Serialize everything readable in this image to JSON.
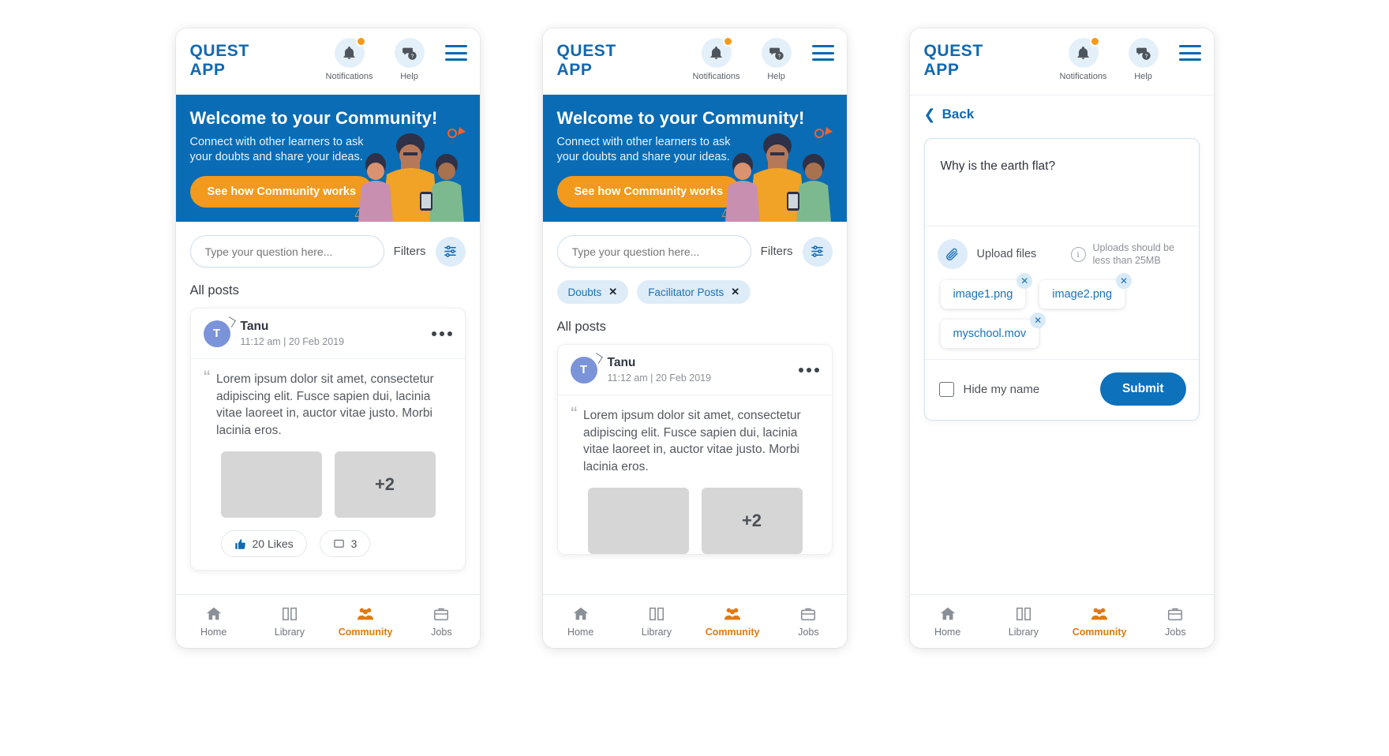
{
  "colors": {
    "brand_blue": "#1168b0",
    "hero_blue": "#0a6cb4",
    "accent_orange": "#f29a1d",
    "active_nav_orange": "#e07a10",
    "chip_blue_bg": "#deecf8",
    "link_blue": "#1a72b8"
  },
  "header": {
    "logo_line1": "QUEST",
    "logo_line2": "APP",
    "notifications_icon": "bell-icon",
    "notifications_label": "Notifications",
    "help_icon": "chat-question-icon",
    "help_label": "Help",
    "menu_icon": "hamburger-menu-icon"
  },
  "hero": {
    "title": "Welcome to your Community!",
    "subtitle": "Connect with other learners to ask your doubts and share your ideas.",
    "cta_label": "See how Community works"
  },
  "search": {
    "placeholder": "Type your question here...",
    "filters_label": "Filters",
    "filters_icon": "sliders-icon"
  },
  "filters_applied": [
    {
      "label": "Doubts",
      "remove_icon": "close-x-icon"
    },
    {
      "label": "Facilitator Posts",
      "remove_icon": "close-x-icon"
    }
  ],
  "feed": {
    "section_title": "All posts",
    "post": {
      "avatar_initial": "T",
      "author": "Tanu",
      "timestamp": "11:12 am | 20 Feb 2019",
      "more_icon": "more-options-icon",
      "quote_icon": "quote-mark-icon",
      "body": "Lorem ipsum dolor sit amet, consectetur adipiscing elit. Fusce sapien dui, lacinia vitae laoreet in, auctor vitae justo. Morbi lacinia eros.",
      "attachments": [
        {
          "type": "image-thumbnail",
          "label": ""
        },
        {
          "type": "image-thumbnail-overflow",
          "label": "+2"
        }
      ],
      "actions": [
        {
          "label": "20 Likes",
          "icon": "thumbs-up-icon"
        },
        {
          "label": "3",
          "icon": "comment-icon"
        }
      ]
    }
  },
  "detail": {
    "back_label": "Back",
    "back_icon": "chevron-left-icon",
    "question_value": "Why is the earth flat?",
    "question_placeholder": "Type your question here...",
    "upload_icon": "paperclip-icon",
    "upload_label": "Upload files",
    "info_icon": "info-circle-icon",
    "upload_hint": "Uploads should be less than 25MB",
    "files": [
      {
        "name": "image1.png",
        "remove_icon": "close-x-icon"
      },
      {
        "name": "image2.png",
        "remove_icon": "close-x-icon"
      },
      {
        "name": "myschool.mov",
        "remove_icon": "close-x-icon"
      }
    ],
    "hide_name_label": "Hide my name",
    "hide_name_checked": false,
    "submit_label": "Submit"
  },
  "bottom_nav": [
    {
      "label": "Home",
      "icon": "home-icon",
      "active": false
    },
    {
      "label": "Library",
      "icon": "book-icon",
      "active": false
    },
    {
      "label": "Community",
      "icon": "people-group-icon",
      "active": true
    },
    {
      "label": "Jobs",
      "icon": "briefcase-icon",
      "active": false
    }
  ]
}
